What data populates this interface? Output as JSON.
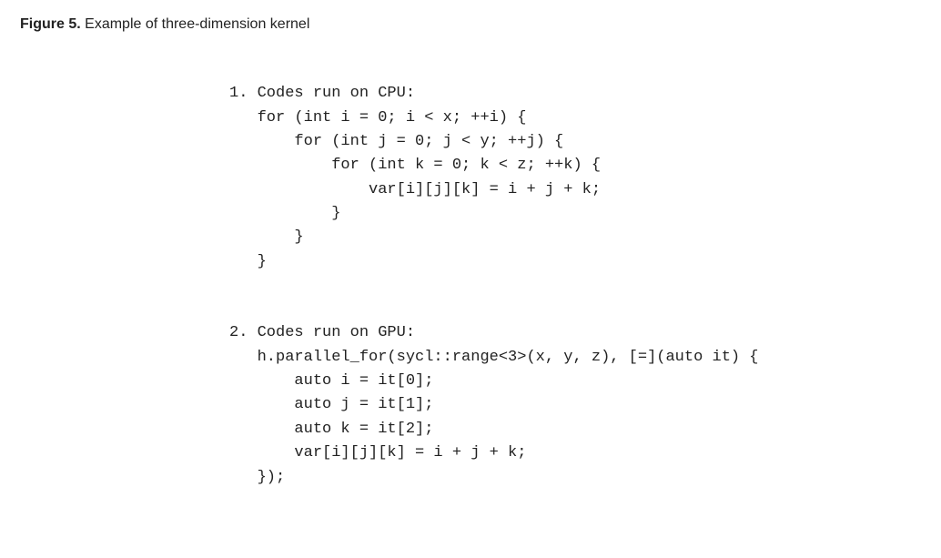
{
  "figure": {
    "label": "Figure 5.",
    "caption": "Example of three-dimension kernel"
  },
  "section1": {
    "title": "1. Codes run on CPU:",
    "lines": [
      "   for (int i = 0; i < x; ++i) {",
      "       for (int j = 0; j < y; ++j) {",
      "           for (int k = 0; k < z; ++k) {",
      "               var[i][j][k] = i + j + k;",
      "           }",
      "       }",
      "   }"
    ]
  },
  "section2": {
    "title": "2. Codes run on GPU:",
    "lines": [
      "   h.parallel_for(sycl::range<3>(x, y, z), [=](auto it) {",
      "       auto i = it[0];",
      "       auto j = it[1];",
      "       auto k = it[2];",
      "       var[i][j][k] = i + j + k;",
      "   });"
    ]
  }
}
